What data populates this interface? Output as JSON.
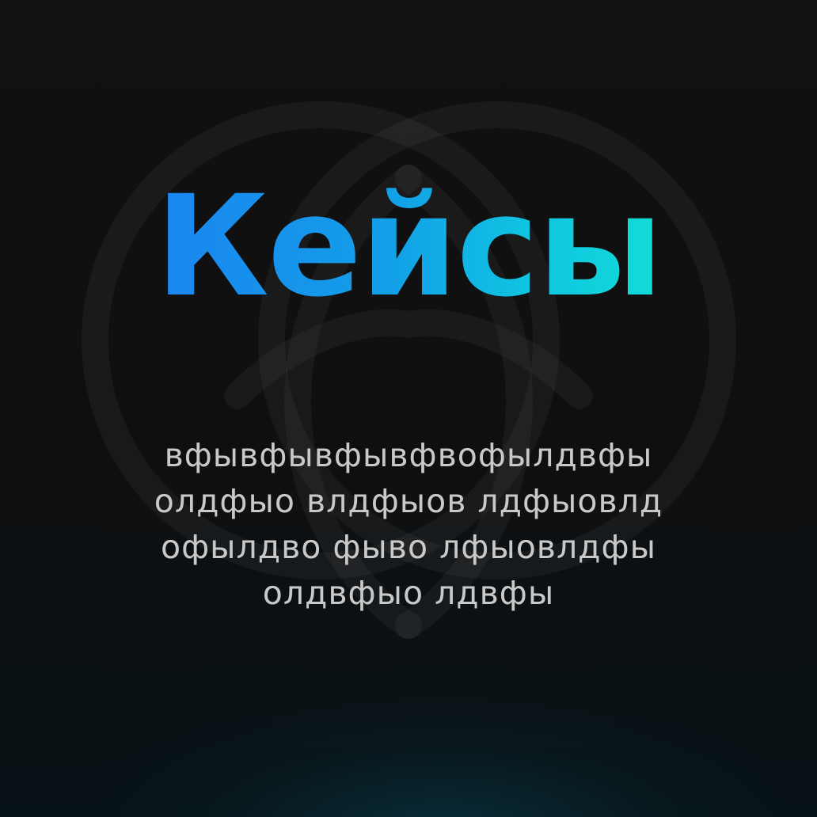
{
  "title": "Кейсы",
  "description_lines": [
    "вфывфывфывфвофылдвфы",
    "олдфыо влдфыов лдфыовлд",
    "офылдво фыво лфыовлдфы",
    "олдвфыо лдвфы"
  ],
  "colors": {
    "background": "#101010",
    "title_gradient_start": "#1a86f0",
    "title_gradient_end": "#12dcd8",
    "description_text": "#c9c9c9",
    "bottom_glow": "#0a4658"
  },
  "icons": {
    "background_emblem": "intertwined-rings-emblem-icon"
  }
}
